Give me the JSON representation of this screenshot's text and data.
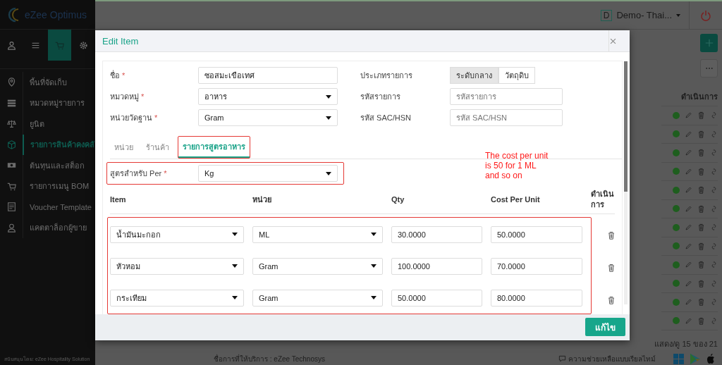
{
  "app": {
    "logo": "eZee Optimus",
    "property_badge": "D",
    "property_name": "Demo- Thai..."
  },
  "sidebar": {
    "tabs": [
      {
        "selected": false
      },
      {
        "selected": false
      },
      {
        "selected": true
      },
      {
        "selected": false
      }
    ],
    "items": [
      {
        "label": "พื้นที่จัดเก็บ",
        "selected": false
      },
      {
        "label": "หมวดหมู่รายการ",
        "selected": false
      },
      {
        "label": "ยูนิต",
        "selected": false
      },
      {
        "label": "รายการสินค้าคงคลั",
        "selected": true
      },
      {
        "label": "ต้นทุนและสต็อก",
        "selected": false
      },
      {
        "label": "รายการเมนู BOM",
        "selected": false
      },
      {
        "label": "Voucher Template",
        "selected": false
      },
      {
        "label": "แคตตาล็อกผู้ขาย",
        "selected": false
      }
    ],
    "credit": "สนับสนุนโดย: eZee Hospitality Solution"
  },
  "list": {
    "actions_header": "ดำเนินการ",
    "rows": [
      {
        "active": true
      },
      {
        "active": true
      },
      {
        "active": true
      },
      {
        "active": true
      },
      {
        "active": true
      },
      {
        "active": true
      },
      {
        "active": true
      },
      {
        "active": true
      },
      {
        "active": true
      },
      {
        "active": true
      },
      {
        "active": true
      },
      {
        "active": true
      }
    ],
    "pagination": "แสดง/ดู 15 ของ 21"
  },
  "footer": {
    "provider": "ชื่อการที่ให้บริการ : eZee Technosys",
    "help": "ความช่วยเหลือแบบเรียลไทม์"
  },
  "dialog": {
    "title": "Edit Item",
    "form_rows": [
      {
        "left": {
          "label": "ชื่อ",
          "required_mark": "*",
          "kind": "text",
          "value": "ซอสมะเขือเทศ"
        },
        "right": {
          "label": "ประเภทรายการ",
          "kind": "segmented",
          "options": [
            {
              "label": "ระดับกลาง",
              "selected": true
            },
            {
              "label": "วัตถุดิบ",
              "selected": false
            }
          ]
        }
      },
      {
        "left": {
          "label": "หมวดหมู่",
          "required_mark": "*",
          "kind": "select",
          "value": "อาหาร"
        },
        "right": {
          "label": "รหัสรายการ",
          "kind": "text",
          "placeholder": "รหัสรายการ"
        }
      },
      {
        "left": {
          "label": "หน่วยวัดฐาน",
          "required_mark": "*",
          "kind": "select",
          "value": "Gram"
        },
        "right": {
          "label": "รหัส SAC/HSN",
          "kind": "text",
          "placeholder": "รหัส SAC/HSN"
        }
      }
    ],
    "tabs": [
      {
        "label": "หน่วย",
        "selected": false,
        "highlighted": false
      },
      {
        "label": "ร้านค้า",
        "selected": false,
        "highlighted": false
      },
      {
        "label": "รายการสูตรอาหาร",
        "selected": true,
        "highlighted": true
      }
    ],
    "recipe_per": {
      "label": "สูตรสำหรับ Per",
      "required_mark": "*",
      "value": "Kg",
      "highlighted": true
    },
    "columns": [
      "Item",
      "หน่วย",
      "Qty",
      "Cost Per Unit",
      "ดำเนินการ"
    ],
    "rows_highlighted": true,
    "rows": [
      {
        "item": "น้ำมันมะกอก",
        "unit": "ML",
        "qty": "30.0000",
        "cost": "50.0000"
      },
      {
        "item": "หัวหอม",
        "unit": "Gram",
        "qty": "100.0000",
        "cost": "70.0000"
      },
      {
        "item": "กระเทียม",
        "unit": "Gram",
        "qty": "50.0000",
        "cost": "80.0000"
      }
    ],
    "save_button": "แก้ไข",
    "annotation": [
      "The cost per unit",
      "is 50 for 1 ML",
      "and so on"
    ]
  }
}
